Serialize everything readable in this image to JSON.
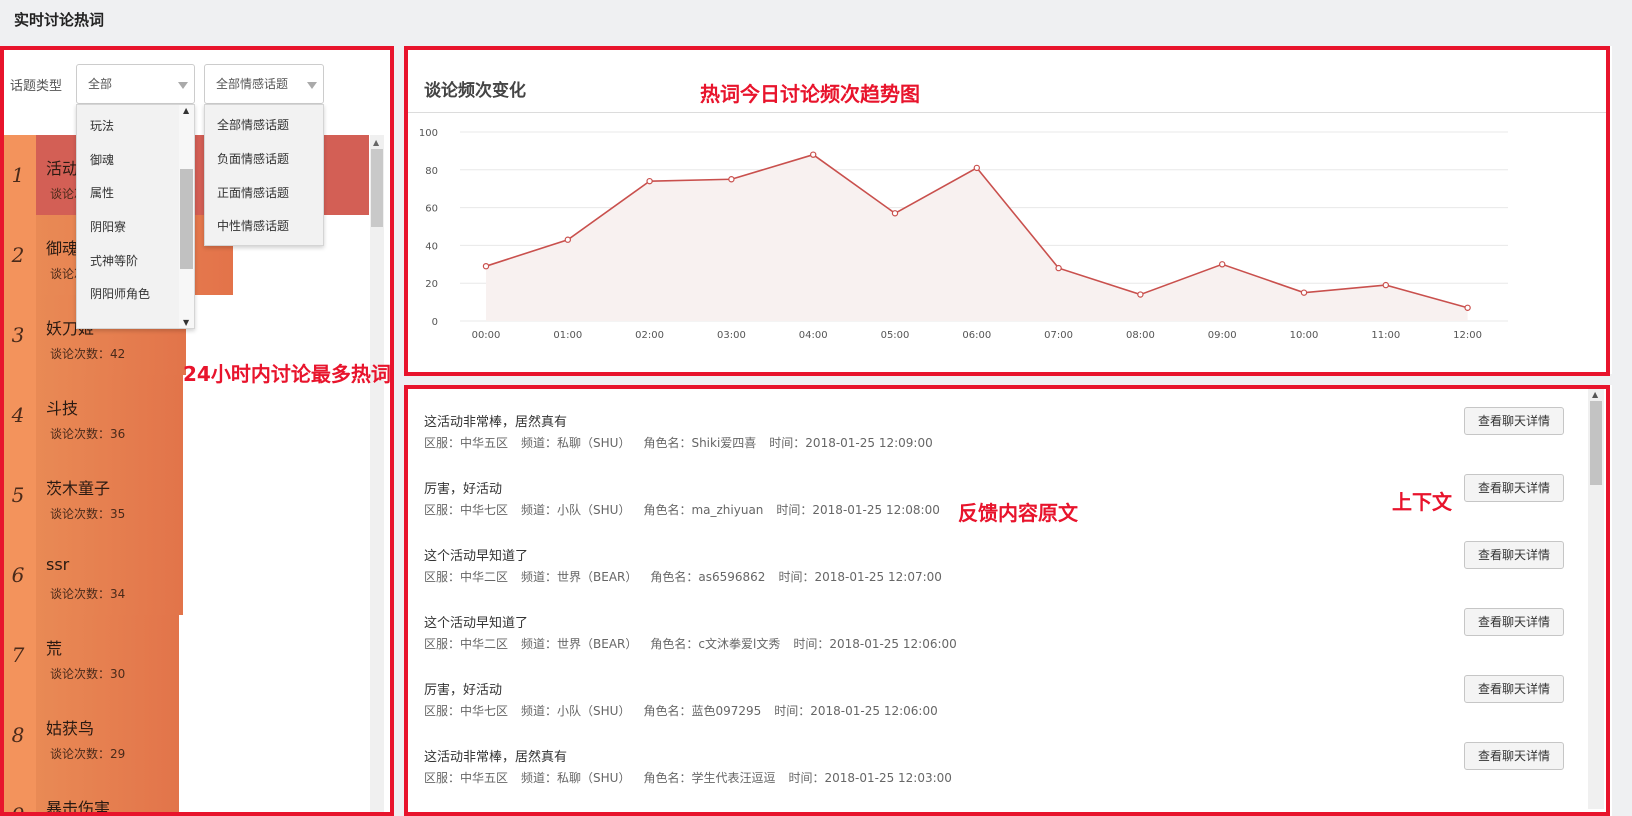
{
  "page": {
    "title": "实时讨论热词"
  },
  "filters": {
    "topic_label": "话题类型",
    "topic_value": "全部",
    "sentiment_value": "全部情感话题",
    "topic_options": [
      "玩法",
      "御魂",
      "属性",
      "阴阳寮",
      "式神等阶",
      "阴阳师角色"
    ],
    "sentiment_options": [
      "全部情感话题",
      "负面情感话题",
      "正面情感话题",
      "中性情感话题"
    ]
  },
  "ranking": {
    "count_prefix": "谈论次数：",
    "items": [
      {
        "rank": "1",
        "name": "活动",
        "count": "",
        "count_text": "谈论次数：",
        "bar": 0.93,
        "color": "#d35f55"
      },
      {
        "rank": "2",
        "name": "御魂",
        "count_text": "谈论次数：",
        "bar": 0.55,
        "color": "#e3734a"
      },
      {
        "rank": "3",
        "name": "妖刀姬",
        "count_text": "谈论次数：42",
        "bar": 0.42,
        "color": "#e2744a"
      },
      {
        "rank": "4",
        "name": "斗技",
        "count_text": "谈论次数：36",
        "bar": 0.41,
        "color": "#e2744a"
      },
      {
        "rank": "5",
        "name": "茨木童子",
        "count_text": "谈论次数：35",
        "bar": 0.41,
        "color": "#e2744a"
      },
      {
        "rank": "6",
        "name": "ssr",
        "count_text": "谈论次数：34",
        "bar": 0.41,
        "color": "#e2744a"
      },
      {
        "rank": "7",
        "name": "荒",
        "count_text": "谈论次数：30",
        "bar": 0.4,
        "color": "#e2744a"
      },
      {
        "rank": "8",
        "name": "姑获鸟",
        "count_text": "谈论次数：29",
        "bar": 0.4,
        "color": "#e2744a"
      },
      {
        "rank": "9",
        "name": "暴击伤害",
        "count_text": "",
        "bar": 0.4,
        "color": "#e2744a"
      }
    ]
  },
  "chart_data": {
    "type": "area",
    "title": "谈论频次变化",
    "x": [
      "00:00",
      "01:00",
      "02:00",
      "03:00",
      "04:00",
      "05:00",
      "06:00",
      "07:00",
      "08:00",
      "09:00",
      "10:00",
      "11:00",
      "12:00"
    ],
    "series": [
      {
        "values": [
          29,
          43,
          74,
          75,
          88,
          57,
          81,
          28,
          14,
          30,
          15,
          19,
          7
        ]
      }
    ],
    "ylim": [
      0,
      100
    ],
    "yticks": [
      0,
      20,
      40,
      60,
      80,
      100
    ],
    "grid": true,
    "line_color": "#c9504d",
    "fill_color": "#f8f1f0"
  },
  "feedback": {
    "button_label": "查看聊天详情",
    "items": [
      {
        "text": "这活动非常棒，居然真有",
        "server": "区服：中华五区",
        "channel": "频道：私聊（SHU）",
        "role": "角色名：Shiki爱四喜",
        "time": "时间：2018-01-25 12:09:00"
      },
      {
        "text": "厉害，好活动",
        "server": "区服：中华七区",
        "channel": "频道：小队（SHU）",
        "role": "角色名：ma_zhiyuan",
        "time": "时间：2018-01-25 12:08:00"
      },
      {
        "text": "这个活动早知道了",
        "server": "区服：中华二区",
        "channel": "频道：世界（BEAR）",
        "role": "角色名：as6596862",
        "time": "时间：2018-01-25 12:07:00"
      },
      {
        "text": "这个活动早知道了",
        "server": "区服：中华二区",
        "channel": "频道：世界（BEAR）",
        "role": "角色名：c文沐拳爱l文秀",
        "time": "时间：2018-01-25 12:06:00"
      },
      {
        "text": "厉害，好活动",
        "server": "区服：中华七区",
        "channel": "频道：小队（SHU）",
        "role": "角色名：蓝色097295",
        "time": "时间：2018-01-25 12:06:00"
      },
      {
        "text": "这活动非常棒，居然真有",
        "server": "区服：中华五区",
        "channel": "频道：私聊（SHU）",
        "role": "角色名：学生代表汪逗逗",
        "time": "时间：2018-01-25 12:03:00"
      }
    ]
  },
  "annotations": {
    "ranking": "24小时内讨论最多热词",
    "chart": "热词今日讨论频次趋势图",
    "feedback": "反馈内容原文",
    "context": "上下文",
    "color": "#e8142c"
  }
}
